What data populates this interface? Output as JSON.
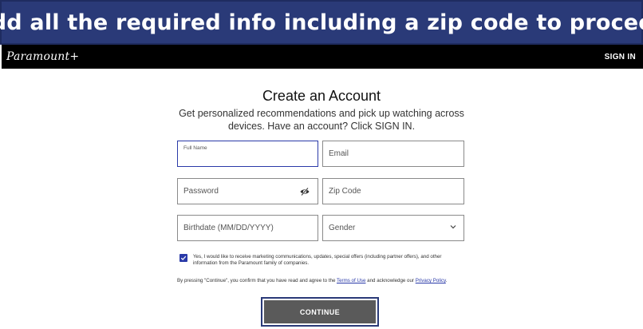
{
  "banner": {
    "text": "Add all the required info including a zip code to proceed"
  },
  "header": {
    "logo": "Paramount+",
    "sign_in_label": "SIGN IN"
  },
  "form": {
    "title": "Create an Account",
    "subtitle": "Get personalized recommendations and pick up watching across devices. Have an account? Click SIGN IN.",
    "full_name_label": "Full Name",
    "email_placeholder": "Email",
    "password_placeholder": "Password",
    "zip_placeholder": "Zip Code",
    "birthdate_placeholder": "Birthdate (MM/DD/YYYY)",
    "gender_placeholder": "Gender",
    "marketing_checked": true,
    "marketing_text": "Yes, I would like to receive marketing communications, updates, special offers (including partner offers), and other information from the Paramount family of companies.",
    "terms_prefix": "By pressing \"Continue\", you confirm that you have read and agree to the ",
    "terms_link": "Terms of Use",
    "terms_middle": " and acknowledge our ",
    "privacy_link": "Privacy Policy",
    "terms_suffix": ".",
    "continue_label": "CONTINUE"
  },
  "icons": {
    "password_toggle": "eye-slash-icon",
    "gender_dropdown": "chevron-down-icon",
    "marketing_check": "checkmark-icon"
  },
  "colors": {
    "banner_bg": "#2a3a78",
    "header_bg": "#000000",
    "accent": "#2a3aa8",
    "button_bg": "#5a5a5a"
  }
}
